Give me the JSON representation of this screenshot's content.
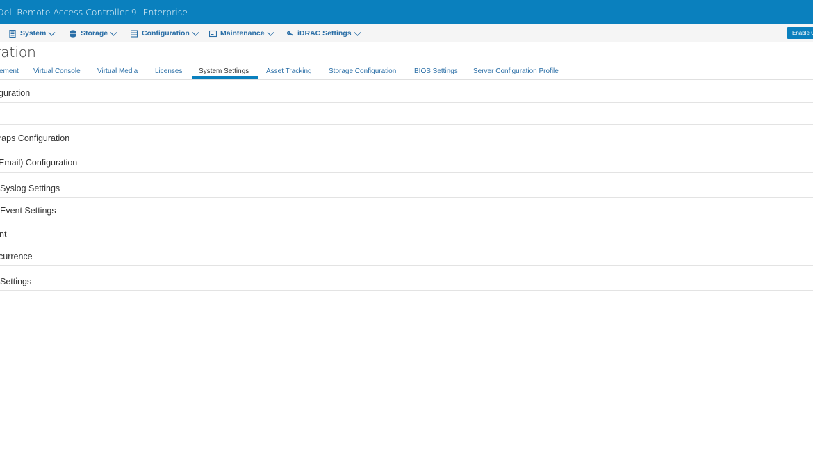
{
  "header": {
    "app_title": "Dell Remote Access Controller 9",
    "edition": "Enterprise"
  },
  "nav": {
    "items": [
      {
        "label": "System",
        "icon": "server-icon"
      },
      {
        "label": "Storage",
        "icon": "database-icon"
      },
      {
        "label": "Configuration",
        "icon": "configuration-icon"
      },
      {
        "label": "Maintenance",
        "icon": "maintenance-icon"
      },
      {
        "label": "iDRAC Settings",
        "icon": "key-icon"
      }
    ],
    "enable_button_label": "Enable G"
  },
  "page": {
    "title": "ration"
  },
  "tabs": [
    {
      "label": "ement",
      "active": false
    },
    {
      "label": "Virtual Console",
      "active": false
    },
    {
      "label": "Virtual Media",
      "active": false
    },
    {
      "label": "Licenses",
      "active": false
    },
    {
      "label": "System Settings",
      "active": true
    },
    {
      "label": "Asset Tracking",
      "active": false
    },
    {
      "label": "Storage Configuration",
      "active": false
    },
    {
      "label": "BIOS Settings",
      "active": false
    },
    {
      "label": "Server Configuration Profile",
      "active": false
    }
  ],
  "sections": [
    {
      "label": "guration"
    },
    {
      "label": ""
    },
    {
      "label": "raps Configuration"
    },
    {
      "label": "Email) Configuration"
    },
    {
      "label": "Syslog Settings"
    },
    {
      "label": "Event Settings"
    },
    {
      "label": "nt"
    },
    {
      "label": "currence"
    },
    {
      "label": "Settings"
    }
  ],
  "colors": {
    "brand_blue": "#0a80be",
    "link_blue": "#2a6ea6"
  }
}
